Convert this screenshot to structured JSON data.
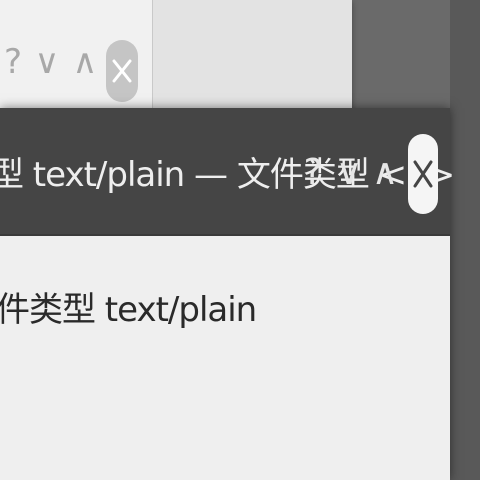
{
  "background_window": {
    "buttons": {
      "help": "?",
      "minimize": "∨",
      "maximize": "∧"
    }
  },
  "dialog": {
    "title": "型 text/plain — 文件类型 <2>",
    "buttons": {
      "help": "?",
      "minimize": "∨",
      "maximize": "∧"
    },
    "content_label": "件类型 text/plain"
  },
  "icons": {
    "close": "close-icon"
  },
  "colors": {
    "titlebar_active": "#454545",
    "window_background": "#efefef",
    "close_button_active": "#f5f5f5"
  }
}
